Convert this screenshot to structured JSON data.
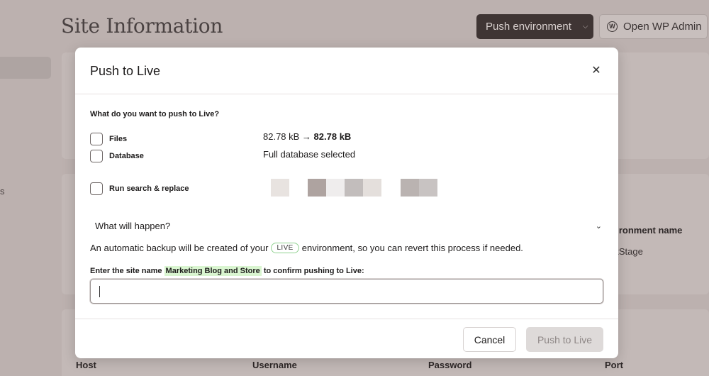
{
  "background": {
    "page_title": "Site Information",
    "push_env_label": "Push environment",
    "open_wp_label": "Open WP Admin",
    "sidebar_fragment": "s",
    "env_name_label": "vironment name",
    "env_name_value": "rkStage",
    "columns": [
      "Host",
      "Username",
      "Password",
      "Port"
    ]
  },
  "modal": {
    "title": "Push to Live",
    "question": "What do you want to push to Live?",
    "options": [
      {
        "label": "Files",
        "checked": false
      },
      {
        "label": "Database",
        "checked": false
      },
      {
        "label": "Run search & replace",
        "checked": false
      }
    ],
    "files_size_from": "82.78 kB → ",
    "files_size_to": "82.78 kB",
    "database_info": "Full database selected",
    "accordion_label": "What will happen?",
    "backup_prefix": "An automatic backup will be created of your",
    "backup_badge": "LIVE",
    "backup_suffix": "environment, so you can revert this process if needed.",
    "confirm_prefix": "Enter the site name ",
    "confirm_site_name": "Marketing Blog and Store",
    "confirm_suffix": " to confirm pushing to Live:",
    "confirm_input_value": "",
    "cancel_label": "Cancel",
    "push_label": "Push to Live"
  },
  "colors": {
    "overlay_bg": "#bcb1af",
    "primary_dark": "#3f3534",
    "live_badge_border": "#8fd18f",
    "site_name_highlight": "#d9f5d0",
    "disabled_button": "#dedad9"
  },
  "icons": {
    "close": "close-icon",
    "accordion": "chevron-down-icon",
    "push_env": "chevron-down-icon",
    "wp": "wordpress-icon"
  }
}
